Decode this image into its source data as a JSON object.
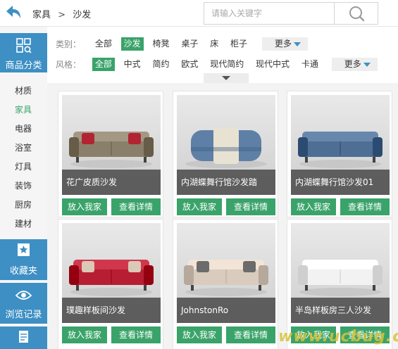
{
  "header": {
    "back_icon": "back-arrow-icon",
    "breadcrumb": [
      "家具",
      "沙发"
    ],
    "breadcrumb_sep": ">",
    "search_placeholder": "请输入关键字",
    "search_icon": "search-icon"
  },
  "sidebar": {
    "top": {
      "label": "商品分类",
      "icon": "grid-icon"
    },
    "categories": [
      {
        "label": "材质",
        "active": false
      },
      {
        "label": "家具",
        "active": true
      },
      {
        "label": "电器",
        "active": false
      },
      {
        "label": "浴室",
        "active": false
      },
      {
        "label": "灯具",
        "active": false
      },
      {
        "label": "装饰",
        "active": false
      },
      {
        "label": "厨房",
        "active": false
      },
      {
        "label": "建材",
        "active": false
      }
    ],
    "favorites": {
      "label": "收藏夹",
      "icon": "star-folder-icon"
    },
    "history": {
      "label": "浏览记录",
      "icon": "eye-icon"
    },
    "more_icon": "document-icon"
  },
  "filters": {
    "category": {
      "label": "类别：",
      "options": [
        "全部",
        "沙发",
        "椅凳",
        "桌子",
        "床",
        "柜子"
      ],
      "selected": "沙发",
      "more": "更多"
    },
    "style": {
      "label": "风格：",
      "options": [
        "全部",
        "中式",
        "简约",
        "欧式",
        "现代简约",
        "现代中式",
        "卡通"
      ],
      "selected": "全部",
      "more": "更多"
    }
  },
  "products": [
    {
      "title": "花广皮质沙发",
      "add_label": "放入我家",
      "detail_label": "查看详情",
      "sofa_color": "#8a7f6a",
      "pillow_color": "#b22432"
    },
    {
      "title": "内湖蝶舞行馆沙发踏",
      "add_label": "放入我家",
      "detail_label": "查看详情",
      "sofa_color": "#5f80a6",
      "pillow_color": "#e8e2d2"
    },
    {
      "title": "内湖蝶舞行馆沙发01",
      "add_label": "放入我家",
      "detail_label": "查看详情",
      "sofa_color": "#4f6e93",
      "pillow_color": "#4f6e93"
    },
    {
      "title": "璞趣样板间沙发",
      "add_label": "放入我家",
      "detail_label": "查看详情",
      "sofa_color": "#b81e33",
      "pillow_color": "#d9c9b6"
    },
    {
      "title": "JohnstonRo",
      "add_label": "放入我家",
      "detail_label": "查看详情",
      "sofa_color": "#d9cbbd",
      "pillow_color": "#6b6b6b"
    },
    {
      "title": "半岛样板房三人沙发",
      "add_label": "放入我家",
      "detail_label": "查看详情",
      "sofa_color": "#f2f2f2",
      "pillow_color": "#f2f2f2"
    }
  ],
  "colors": {
    "green": "#3aa36a",
    "blue": "#3d8fc4"
  },
  "watermark": "www.ucbug.com"
}
